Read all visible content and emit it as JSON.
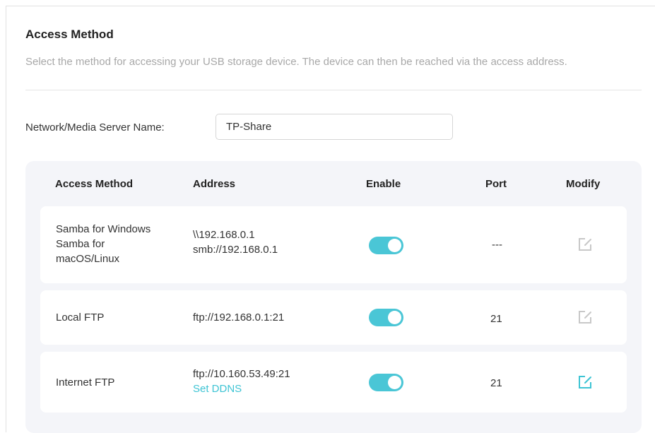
{
  "section": {
    "title": "Access Method",
    "description": "Select the method for accessing your USB storage device. The device can then be reached via the access address."
  },
  "server_name": {
    "label": "Network/Media Server Name:",
    "value": "TP-Share"
  },
  "table": {
    "headers": {
      "method": "Access Method",
      "address": "Address",
      "enable": "Enable",
      "port": "Port",
      "modify": "Modify"
    },
    "rows": [
      {
        "method_line1": "Samba for Windows",
        "method_line2": "Samba for",
        "method_line3": "macOS/Linux",
        "address_line1": "\\\\192.168.0.1",
        "address_line2": "smb://192.168.0.1",
        "enabled": true,
        "port": "---",
        "modify_active": false
      },
      {
        "method": "Local FTP",
        "address": "ftp://192.168.0.1:21",
        "enabled": true,
        "port": "21",
        "modify_active": false
      },
      {
        "method": "Internet FTP",
        "address": "ftp://10.160.53.49:21",
        "link": "Set DDNS",
        "enabled": true,
        "port": "21",
        "modify_active": true
      }
    ]
  },
  "colors": {
    "accent": "#4ac6d6",
    "link": "#3ec4d4",
    "icon_disabled": "#c8c8c8",
    "icon_active": "#3ec4d4",
    "table_bg": "#f4f5f9"
  },
  "icons": {
    "toggle": "toggle-switch-on",
    "modify": "edit-icon"
  }
}
